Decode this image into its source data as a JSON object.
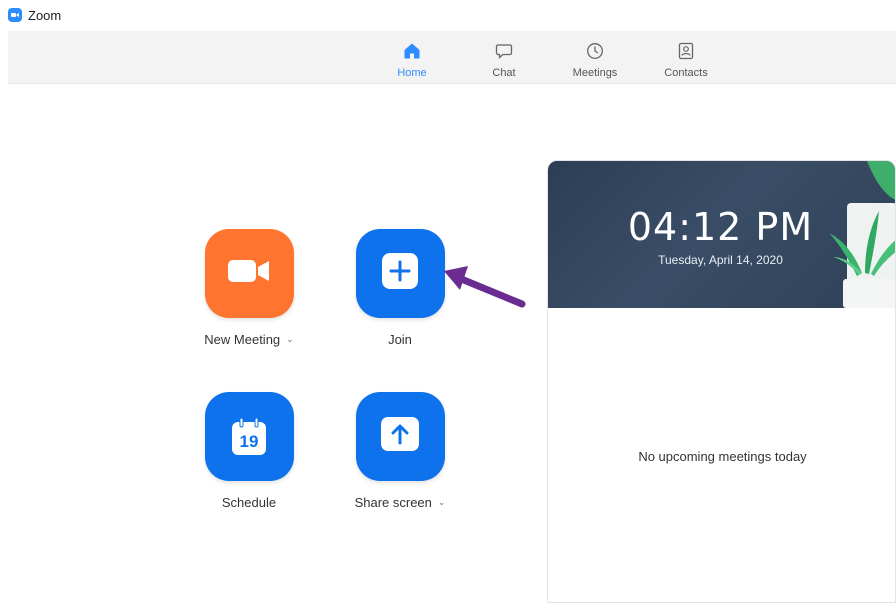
{
  "app": {
    "title": "Zoom",
    "logo_icon": "zoom-camera-icon"
  },
  "nav": {
    "items": [
      {
        "label": "Home",
        "icon": "home-icon",
        "active": true
      },
      {
        "label": "Chat",
        "icon": "chat-bubble-icon",
        "active": false
      },
      {
        "label": "Meetings",
        "icon": "clock-icon",
        "active": false
      },
      {
        "label": "Contacts",
        "icon": "contact-card-icon",
        "active": false
      }
    ]
  },
  "actions": {
    "new_meeting": {
      "label": "New Meeting",
      "icon": "video-camera-icon",
      "color": "#ff742e",
      "has_dropdown": true
    },
    "join": {
      "label": "Join",
      "icon": "plus-icon",
      "color": "#0e72ed"
    },
    "schedule": {
      "label": "Schedule",
      "icon": "calendar-icon",
      "calendar_day": "19",
      "color": "#0e72ed"
    },
    "share_screen": {
      "label": "Share screen",
      "icon": "upload-arrow-icon",
      "color": "#0e72ed",
      "has_dropdown": true
    }
  },
  "annotation": {
    "icon": "purple-arrow-icon",
    "color": "#6a2c91"
  },
  "panel": {
    "time": "04:12 PM",
    "date": "Tuesday, April 14, 2020",
    "empty_message": "No upcoming meetings today"
  },
  "colors": {
    "accent": "#2d8cff",
    "orange": "#ff742e",
    "blue": "#0e72ed"
  }
}
